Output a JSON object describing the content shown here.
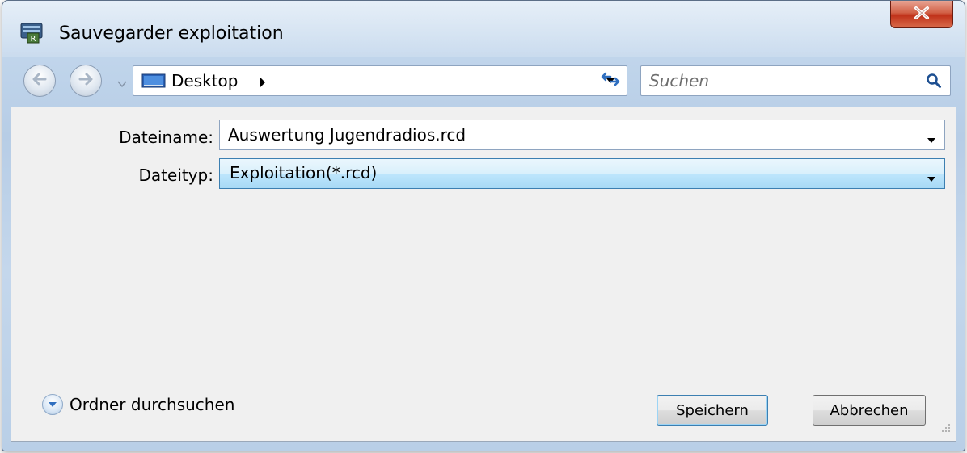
{
  "window": {
    "title": "Sauvegarder exploitation"
  },
  "navigation": {
    "address_location": "Desktop",
    "search_placeholder": "Suchen"
  },
  "form": {
    "filename_label": "Dateiname:",
    "filename_value": "Auswertung Jugendradios.rcd",
    "filetype_label": "Dateityp:",
    "filetype_value": "Exploitation(*.rcd)"
  },
  "footer": {
    "browse_label": "Ordner durchsuchen",
    "save_label": "Speichern",
    "cancel_label": "Abbrechen"
  },
  "colors": {
    "frame": "#c4d7ec",
    "panel": "#f0f0f0",
    "close_button": "#c0321a",
    "accent": "#3c7fb1"
  },
  "icons": {
    "app": "app-icon",
    "close": "close-icon",
    "back": "back-arrow-icon",
    "forward": "forward-arrow-icon",
    "history": "chevron-down-icon",
    "location": "desktop-icon",
    "breadcrumb": "chevron-right-icon",
    "refresh": "refresh-icon",
    "search": "search-icon",
    "browse": "expand-icon",
    "resize": "resize-grip-icon"
  }
}
